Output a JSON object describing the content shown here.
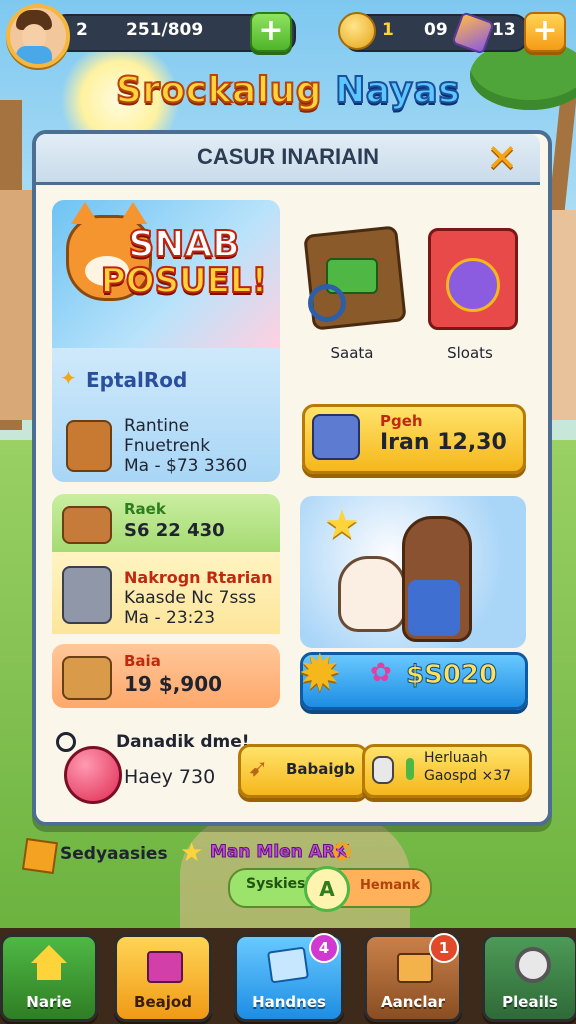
{
  "top_bar": {
    "level": "2",
    "xp": "251/809",
    "coins": "1",
    "coins_value": "09",
    "gems": "13",
    "plus_label": "+"
  },
  "game_title": {
    "part1": "Srockalug",
    "part2": "Nayas"
  },
  "modal": {
    "title": "CASUR INARIAIN",
    "close_label": "✕",
    "hero": {
      "line1": "SNAB",
      "line2": "POSUEL!"
    },
    "section_label": "EptalRod",
    "offer_main": {
      "line1": "Rantine",
      "line2": "Fnuetrenk",
      "line3": "Ma - $73 3360"
    },
    "shop_items": [
      {
        "label": "Saata"
      },
      {
        "label": "Sloats"
      }
    ],
    "buy_button": {
      "line1": "Pgeh",
      "line2": "Iran 12,30"
    },
    "green_offer": {
      "line1": "Raek",
      "line2": "S6 22 430"
    },
    "yellow_offer": {
      "line1": "Nakrogn Rtarian",
      "line2": "Kaasde Nc 7sss",
      "line3": "Ma - 23:23"
    },
    "orange_offer": {
      "line1": "Baia",
      "line2": "19 $,900"
    },
    "pets_price": "$S020",
    "promo": {
      "title": "Danadik dme!",
      "value": "Haey 730"
    },
    "promo_btn1": "Babaigb",
    "promo_btn2": {
      "line1": "Herluaah",
      "line2": "Gaospd ×37"
    }
  },
  "lower": {
    "left_text": "Sedyaasies",
    "right_text": "Man Mlen ARK",
    "toggle_left": "Syskiesh",
    "toggle_mid": "A",
    "toggle_right": "Hemank"
  },
  "nav": [
    {
      "label": "Narie",
      "icon": "home-icon",
      "color": "#3e9a3a"
    },
    {
      "label": "Beajod",
      "icon": "gift-icon",
      "color": "#f3a222"
    },
    {
      "label": "Handnes",
      "icon": "card-icon",
      "color": "#2f86d9",
      "badge": "4"
    },
    {
      "label": "Aanclar",
      "icon": "chest-icon",
      "color": "#b86b2d",
      "badge": "1"
    },
    {
      "label": "Pleails",
      "icon": "settings-icon",
      "color": "#3c7a45"
    }
  ],
  "colors": {
    "accent": "#f5b71c",
    "primary_blue": "#1d8de3",
    "modal_border": "#4b6e92"
  }
}
